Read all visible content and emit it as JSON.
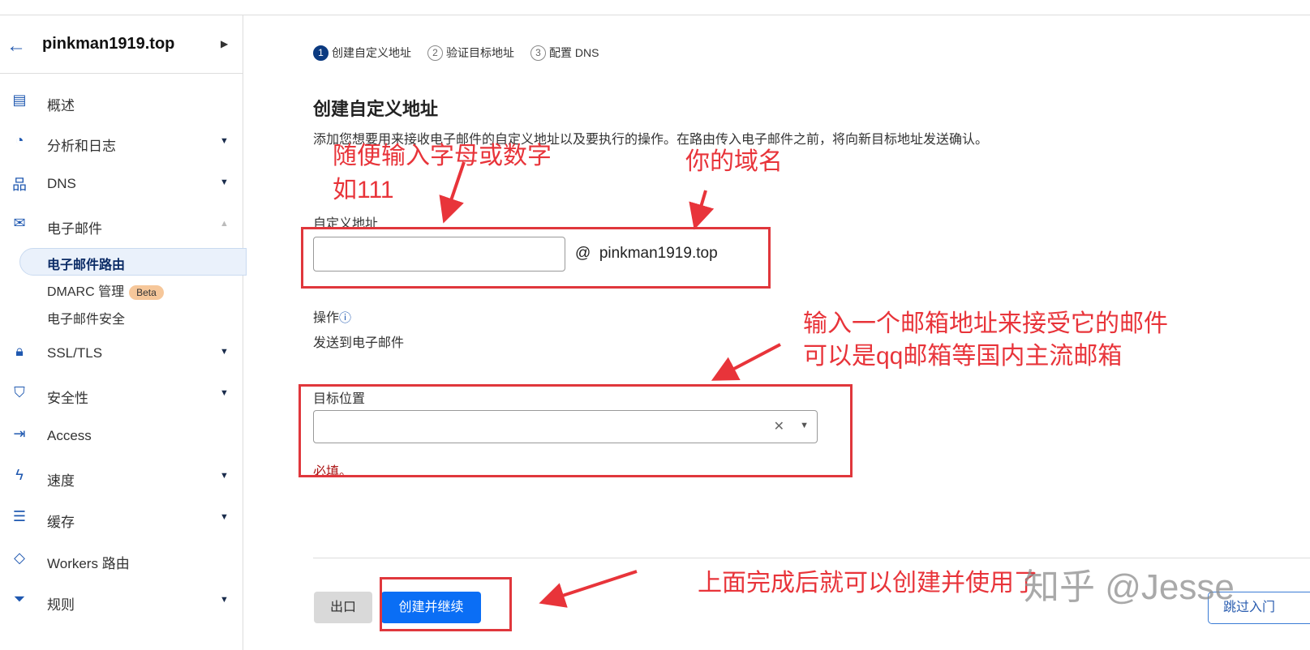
{
  "sidebar": {
    "domain": "pinkman1919.top",
    "back_icon": "arrow-left-icon",
    "items": [
      {
        "label": "概述",
        "icon": "clipboard-icon"
      },
      {
        "label": "分析和日志",
        "icon": "pie-chart-icon"
      },
      {
        "label": "DNS",
        "icon": "network-icon"
      },
      {
        "label": "电子邮件",
        "icon": "mail-icon"
      },
      {
        "label": "SSL/TLS",
        "icon": "lock-icon"
      },
      {
        "label": "安全性",
        "icon": "shield-icon"
      },
      {
        "label": "Access",
        "icon": "access-icon"
      },
      {
        "label": "速度",
        "icon": "lightning-icon"
      },
      {
        "label": "缓存",
        "icon": "storage-icon"
      },
      {
        "label": "Workers 路由",
        "icon": "workers-icon"
      },
      {
        "label": "规则",
        "icon": "filter-icon"
      }
    ],
    "email_sub": {
      "routing": "电子邮件路由",
      "dmarc": "DMARC 管理",
      "beta": "Beta",
      "security": "电子邮件安全"
    }
  },
  "steps": [
    {
      "n": "1",
      "label": "创建自定义地址"
    },
    {
      "n": "2",
      "label": "验证目标地址"
    },
    {
      "n": "3",
      "label": "配置 DNS"
    }
  ],
  "main": {
    "title": "创建自定义地址",
    "description": "添加您想要用来接收电子邮件的自定义地址以及要执行的操作。在路由传入电子邮件之前，将向新目标地址发送确认。",
    "custom_label": "自定义地址",
    "custom_value": "",
    "at": "@",
    "domain": "pinkman1919.top",
    "action_label": "操作",
    "action_value": "发送到电子邮件",
    "target_label": "目标位置",
    "target_value": "",
    "required": "必填。",
    "exit": "出口",
    "create": "创建并继续",
    "skip": "跳过入门"
  },
  "annotations": {
    "a1": "随便输入字母或数字",
    "a2": "如111",
    "a3": "你的域名",
    "a4": "输入一个邮箱地址来接受它的邮件",
    "a5": "可以是qq邮箱等国内主流邮箱",
    "a6": "上面完成后就可以创建并使用了",
    "color": "#e8343a"
  },
  "watermark": "知乎 @Jesse"
}
